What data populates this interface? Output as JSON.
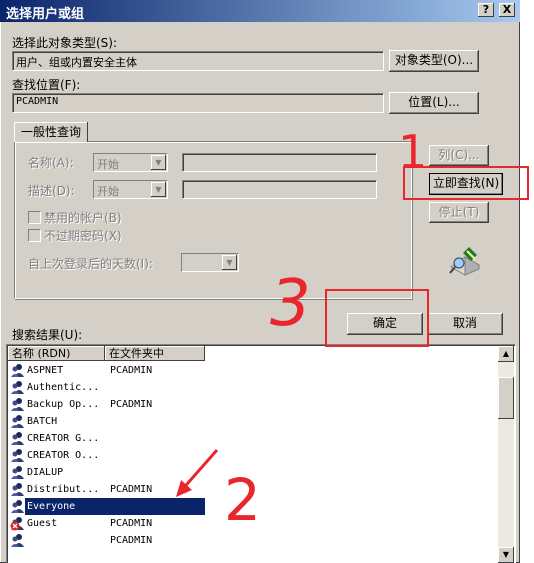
{
  "window": {
    "title": "选择用户或组",
    "help_label": "?",
    "close_label": "X"
  },
  "object_type": {
    "label": "选择此对象类型(S):",
    "value": "用户、组或内置安全主体",
    "button": "对象类型(O)..."
  },
  "location": {
    "label": "查找位置(F):",
    "value": "PCADMIN",
    "button": "位置(L)..."
  },
  "general_query": {
    "tab_label": "一般性查询",
    "name_label": "名称(A):",
    "name_mode": "开始",
    "desc_label": "描述(D):",
    "desc_mode": "开始",
    "disabled_accounts": "禁用的帐户(B)",
    "non_expiring": "不过期密码(X)",
    "days_since_logon": "自上次登录后的天数(I):"
  },
  "actions": {
    "columns": "列(C)...",
    "find_now": "立即查找(N)",
    "stop": "停止(T)",
    "ok": "确定",
    "cancel": "取消"
  },
  "results": {
    "label": "搜索结果(U):",
    "columns": [
      "名称 (RDN)",
      "在文件夹中"
    ],
    "rows": [
      {
        "name": "ASPNET",
        "folder": "PCADMIN"
      },
      {
        "name": "Authentic...",
        "folder": ""
      },
      {
        "name": "Backup Op...",
        "folder": "PCADMIN"
      },
      {
        "name": "BATCH",
        "folder": ""
      },
      {
        "name": "CREATOR G...",
        "folder": ""
      },
      {
        "name": "CREATOR O...",
        "folder": ""
      },
      {
        "name": "DIALUP",
        "folder": ""
      },
      {
        "name": "Distribut...",
        "folder": "PCADMIN"
      },
      {
        "name": "Everyone",
        "folder": ""
      },
      {
        "name": "Guest",
        "folder": "PCADMIN"
      },
      {
        "name": "",
        "folder": "PCADMIN"
      }
    ]
  },
  "annotations": {
    "mark1": "1",
    "mark2": "2",
    "mark3": "3",
    "color": "#e8262b"
  }
}
